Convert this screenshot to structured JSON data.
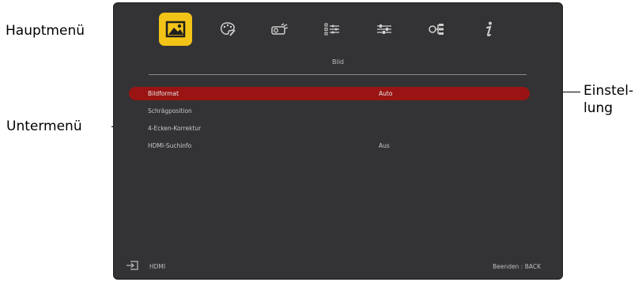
{
  "callouts": {
    "main_menu": "Hauptmenü",
    "submenu": "Untermenü",
    "setting_line1": "Einstel-",
    "setting_line2": "lung"
  },
  "tabs": [
    {
      "icon": "picture-icon",
      "active": true
    },
    {
      "icon": "color-palette-icon",
      "active": false
    },
    {
      "icon": "projector-icon",
      "active": false
    },
    {
      "icon": "settings-list-icon",
      "active": false
    },
    {
      "icon": "sliders-icon",
      "active": false
    },
    {
      "icon": "network-icon",
      "active": false
    },
    {
      "icon": "info-icon",
      "active": false
    }
  ],
  "menu": {
    "title": "Bild",
    "items": [
      {
        "label": "Bildformat",
        "value": "Auto",
        "selected": true
      },
      {
        "label": "Schrägposition",
        "value": "",
        "selected": false
      },
      {
        "label": "4-Ecken-Korrektur",
        "value": "",
        "selected": false
      },
      {
        "label": "HDMI-Suchinfo",
        "value": "Aus",
        "selected": false
      }
    ]
  },
  "footer": {
    "source": "HDMI",
    "exit": "Beenden : BACK"
  },
  "colors": {
    "screen_bg": "#333335",
    "active_tab": "#f2c417",
    "selected_row": "#9a1414"
  }
}
